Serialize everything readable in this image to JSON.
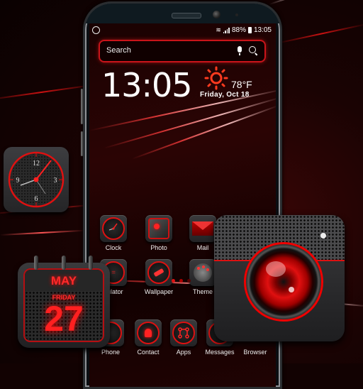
{
  "status_bar": {
    "left_icon": "sync-icon",
    "wifi_icon": "wifi-icon",
    "signal_icon": "signal-icon",
    "battery_percent": "88%",
    "battery_icon": "battery-icon",
    "time": "13:05"
  },
  "search": {
    "placeholder": "Search",
    "mic_icon": "microphone-icon",
    "search_icon": "search-icon"
  },
  "clock_widget": {
    "time": "13:05",
    "weather_icon": "sun-icon",
    "temperature": "78°F",
    "date": "Friday, Oct 18"
  },
  "apps": {
    "row1": [
      {
        "label": "Clock",
        "icon": "clock-icon"
      },
      {
        "label": "Photo",
        "icon": "photo-icon"
      },
      {
        "label": "Mail",
        "icon": "mail-icon"
      }
    ],
    "row2": [
      {
        "label": "Calculator",
        "visible_label": "culator",
        "icon": "calculator-icon"
      },
      {
        "label": "Wallpaper",
        "icon": "paint-roller-icon"
      },
      {
        "label": "Theme",
        "icon": "palette-icon"
      }
    ],
    "dock": [
      {
        "label": "Phone",
        "icon": "phone-icon"
      },
      {
        "label": "Contact",
        "icon": "contact-icon"
      },
      {
        "label": "Apps",
        "icon": "apps-icon"
      },
      {
        "label": "Messages",
        "icon": "messages-icon"
      },
      {
        "label": "Browser",
        "icon": "browser-icon"
      }
    ]
  },
  "page_indicator": {
    "pages": 3,
    "active": 1
  },
  "promo_widgets": {
    "analog_clock": {
      "numerals": [
        "12",
        "3",
        "6",
        "9"
      ]
    },
    "calendar": {
      "month": "MAY",
      "weekday": "FRIDAY",
      "day": "27"
    },
    "camera": {
      "icon": "camera-lens-icon"
    }
  },
  "colors": {
    "accent": "#e01010",
    "background": "#120202",
    "text": "#ffffff"
  }
}
